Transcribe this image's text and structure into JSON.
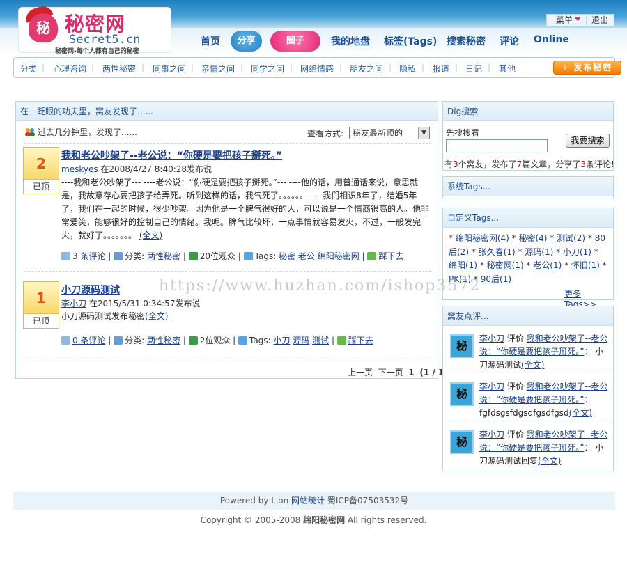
{
  "logo": {
    "badge": "秘",
    "name": "秘密网",
    "site": "Secret5.cn",
    "tagline": "秘密网-每个人都有自己的秘密"
  },
  "user_menu": {
    "menu": "菜单",
    "logout": "退出"
  },
  "main_nav": [
    "首页",
    "分享",
    "圈子",
    "我的地盘",
    "标签(Tags)",
    "搜索秘密",
    "评论",
    "Online"
  ],
  "sub_nav": [
    "分类",
    "心理咨询",
    "两性秘密",
    "同事之间",
    "亲情之间",
    "同学之间",
    "网络情感",
    "朋友之间",
    "隐私",
    "报道",
    "日记",
    "其他"
  ],
  "publish_button": "发布秘密",
  "main": {
    "header": "在一眨眼的功夫里，窝友发现了......",
    "recent": "过去几分钟里，发现了......",
    "view_mode_label": "查看方式:",
    "view_mode_value": "秘友最新顶的",
    "posts": [
      {
        "votes": "2",
        "vote_label": "已顶",
        "title": "我和老公吵架了--老公说：“你硬是要把孩子掰死。”",
        "author": "meskyes",
        "meta": "在2008/4/27 8:40:28发布说",
        "body": "----我和老公吵架了---  ----老公说：“你硬是要把孩子掰死。”---  ----他的话，用普通话来说，意思就是，我故意存心要把孩子给弄死。听到这样的话，我气死了。。。。。。---- 我们相识8年了，结婚5年了，我们在一起的时候，很少吵架。因为他是一个脾气很好的人，可以说是一个情商很高的人。他非常爱笑，能够很好的控制自己的情绪。我呢。脾气比较坏，一点事情就容易发火，不过，一般发完火，就好了。。。。。。。",
        "more": "(全文)",
        "comments": "3 条评论",
        "category_label": "分类:",
        "category": "两性秘密",
        "viewers": "20位观众",
        "tags_label": "Tags:",
        "tags": [
          "秘密",
          "老公",
          "绵阳秘密网"
        ],
        "down": "踩下去"
      },
      {
        "votes": "1",
        "vote_label": "已顶",
        "title": "小刀源码测试",
        "author": "李小刀",
        "meta": "在2015/5/31 0:34:57发布说",
        "body": "小刀源码测试发布秘密",
        "more": "(全文)",
        "comments": "0 条评论",
        "category_label": "分类:",
        "category": "两性秘密",
        "viewers": "2位观众",
        "tags_label": "Tags:",
        "tags": [
          "小刀",
          "源码",
          "测试"
        ],
        "down": "踩下去"
      }
    ],
    "pager": {
      "prev": "上一页",
      "next": "下一页",
      "current": "1",
      "total": "(1 / 1)"
    }
  },
  "sidebar": {
    "dig": {
      "title": "Dig搜索",
      "label": "先搜搜看",
      "button": "我要搜索",
      "stats": [
        "有",
        "3",
        "个窝友，发布了",
        "7",
        "篇文章，分享了",
        "3",
        "条评论!"
      ]
    },
    "system_tags": {
      "title": "系统Tags..."
    },
    "custom_tags": {
      "title": "自定义Tags...",
      "items": [
        "绵阳秘密网(4)",
        "秘密(4)",
        "测试(2)",
        "80后(2)",
        "张久春(1)",
        "源码(1)",
        "小刀(1)",
        "绵阳(1)",
        "秘密网(1)",
        "老公(1)",
        "怀旧(1)",
        "PK(1)",
        "90后(1)"
      ],
      "more": "更多Tags>>"
    },
    "comments": {
      "title": "窝友点评...",
      "items": [
        {
          "avatar": "秘",
          "user": "李小刀",
          "verb": "评价",
          "post": "我和老公吵架了--老公说：“你硬是要把孩子掰死。”",
          "text": "小刀源码测试",
          "more": "(全文)"
        },
        {
          "avatar": "秘",
          "user": "李小刀",
          "verb": "评价",
          "post": "我和老公吵架了--老公说：“你硬是要把孩子掰死。”",
          "text": "fgfdsgsfdgsdfgsdfgsd",
          "more": "(全文)"
        },
        {
          "avatar": "秘",
          "user": "李小刀",
          "verb": "评价",
          "post": "我和老公吵架了--老公说：“你硬是要把孩子掰死。”",
          "text": "小刀源码测试回复",
          "more": "(全文)"
        }
      ]
    }
  },
  "footer": {
    "powered": "Powered by Lion",
    "stats_link": "网站统计",
    "icp": "蜀ICP备07503532号",
    "copyright_pre": "Copyright © 2005-2008",
    "copyright_site": "绵阳秘密网",
    "copyright_post": "All rights reserved."
  },
  "watermark": "https://www.huzhan.com/ishop3572",
  "colors": {
    "nav_blue": "#1a4f9a",
    "pill_blue": "#3a9ad8",
    "pill_pink": "#f0468a",
    "publish_orange": "#f07d05",
    "stat_red": "#d40000"
  }
}
